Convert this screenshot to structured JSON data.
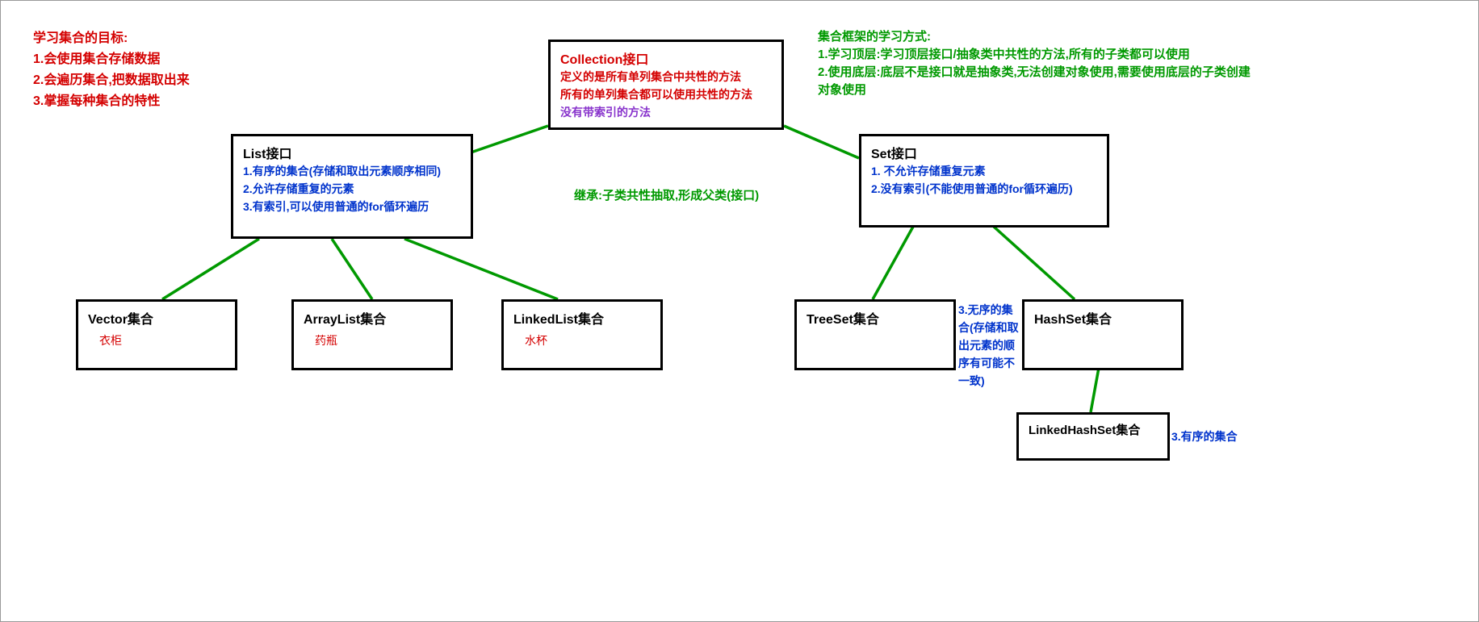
{
  "goals": {
    "title": "学习集合的目标:",
    "l1": "1.会使用集合存储数据",
    "l2": "2.会遍历集合,把数据取出来",
    "l3": "3.掌握每种集合的特性"
  },
  "learn": {
    "title": "集合框架的学习方式:",
    "l1": "1.学习顶层:学习顶层接口/抽象类中共性的方法,所有的子类都可以使用",
    "l2": "2.使用底层:底层不是接口就是抽象类,无法创建对象使用,需要使用底层的子类创建对象使用"
  },
  "inherit": "继承:子类共性抽取,形成父类(接口)",
  "collection": {
    "title": "Collection接口",
    "l1": "定义的是所有单列集合中共性的方法",
    "l2": "所有的单列集合都可以使用共性的方法",
    "l3": "没有带索引的方法"
  },
  "list": {
    "title": "List接口",
    "l1": "1.有序的集合(存储和取出元素顺序相同)",
    "l2": "2.允许存储重复的元素",
    "l3": "3.有索引,可以使用普通的for循环遍历"
  },
  "set": {
    "title": "Set接口",
    "l1": "1. 不允许存储重复元素",
    "l2": "2.没有索引(不能使用普通的for循环遍历)"
  },
  "vector": {
    "title": "Vector集合",
    "sub": "衣柜"
  },
  "arraylist": {
    "title": "ArrayList集合",
    "sub": "药瓶"
  },
  "linkedlist": {
    "title": "LinkedList集合",
    "sub": "水杯"
  },
  "treeset": {
    "title": "TreeSet集合"
  },
  "hashset": {
    "title": "HashSet集合",
    "anno": "3.无序的集合(存储和取出元素的顺序有可能不一致)"
  },
  "linkedhashset": {
    "title": "LinkedHashSet集合",
    "anno": "3.有序的集合"
  }
}
